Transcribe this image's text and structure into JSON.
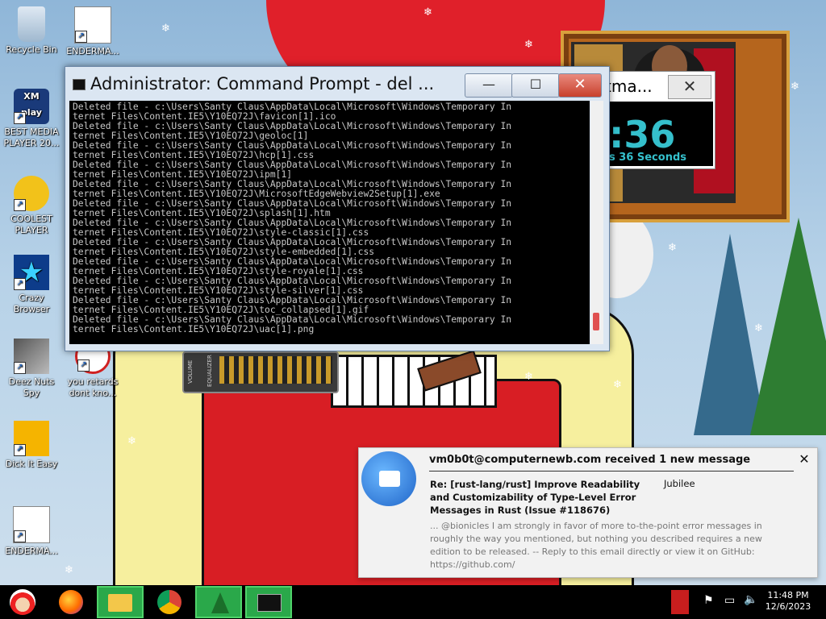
{
  "desktop_icons": [
    {
      "label": "Recycle Bin"
    },
    {
      "label": "ENDERMA..."
    },
    {
      "label": "BEST MEDIA PLAYER 20..."
    },
    {
      "label": "COOLEST PLAYER"
    },
    {
      "label": "Crazy Browser"
    },
    {
      "label": "Deez Nuts Spy"
    },
    {
      "label": "you retards dont kno..."
    },
    {
      "label": "Dick It Easy"
    },
    {
      "label": "ENDERMA..."
    }
  ],
  "xmplay_logo": "XM play",
  "countdown": {
    "title": "tma...",
    "close_glyph": "✕",
    "digits": ":36",
    "subtitle": "s 36 Seconds"
  },
  "cmd_window": {
    "title": "Administrator: Command Prompt - del ...",
    "minimize_glyph": "—",
    "maximize_glyph": "☐",
    "close_glyph": "✕",
    "lines": [
      "Deleted file - c:\\Users\\Santy Claus\\AppData\\Local\\Microsoft\\Windows\\Temporary In",
      "ternet Files\\Content.IE5\\Y10EQ72J\\favicon[1].ico",
      "Deleted file - c:\\Users\\Santy Claus\\AppData\\Local\\Microsoft\\Windows\\Temporary In",
      "ternet Files\\Content.IE5\\Y10EQ72J\\geoloc[1]",
      "Deleted file - c:\\Users\\Santy Claus\\AppData\\Local\\Microsoft\\Windows\\Temporary In",
      "ternet Files\\Content.IE5\\Y10EQ72J\\hcp[1].css",
      "Deleted file - c:\\Users\\Santy Claus\\AppData\\Local\\Microsoft\\Windows\\Temporary In",
      "ternet Files\\Content.IE5\\Y10EQ72J\\ipm[1]",
      "Deleted file - c:\\Users\\Santy Claus\\AppData\\Local\\Microsoft\\Windows\\Temporary In",
      "ternet Files\\Content.IE5\\Y10EQ72J\\MicrosoftEdgeWebview2Setup[1].exe",
      "Deleted file - c:\\Users\\Santy Claus\\AppData\\Local\\Microsoft\\Windows\\Temporary In",
      "ternet Files\\Content.IE5\\Y10EQ72J\\splash[1].htm",
      "Deleted file - c:\\Users\\Santy Claus\\AppData\\Local\\Microsoft\\Windows\\Temporary In",
      "ternet Files\\Content.IE5\\Y10EQ72J\\style-classic[1].css",
      "Deleted file - c:\\Users\\Santy Claus\\AppData\\Local\\Microsoft\\Windows\\Temporary In",
      "ternet Files\\Content.IE5\\Y10EQ72J\\style-embedded[1].css",
      "Deleted file - c:\\Users\\Santy Claus\\AppData\\Local\\Microsoft\\Windows\\Temporary In",
      "ternet Files\\Content.IE5\\Y10EQ72J\\style-royale[1].css",
      "Deleted file - c:\\Users\\Santy Claus\\AppData\\Local\\Microsoft\\Windows\\Temporary In",
      "ternet Files\\Content.IE5\\Y10EQ72J\\style-silver[1].css",
      "Deleted file - c:\\Users\\Santy Claus\\AppData\\Local\\Microsoft\\Windows\\Temporary In",
      "ternet Files\\Content.IE5\\Y10EQ72J\\toc_collapsed[1].gif",
      "Deleted file - c:\\Users\\Santy Claus\\AppData\\Local\\Microsoft\\Windows\\Temporary In",
      "ternet Files\\Content.IE5\\Y10EQ72J\\uac[1].png"
    ]
  },
  "equalizer": {
    "volume_label": "VOLUME",
    "equalizer_label": "EQUALIZER"
  },
  "notification": {
    "header": "vm0b0t@computernewb.com received 1 new message",
    "close_glyph": "✕",
    "subject": "Re: [rust-lang/rust] Improve Readability and Customizability of Type-Level Error Messages in Rust (Issue #118676)",
    "from": "Jubilee",
    "body": "... @bionicles I am strongly in favor of more to-the-point error messages in roughly the way you mentioned, but nothing you described requires a new edition to be released. -- Reply to this email directly or view it on GitHub: https://github.com/"
  },
  "taskbar": {
    "pinned": [
      "start-santa",
      "firefox",
      "file-explorer",
      "chrome",
      "christmas-tree-app",
      "command-prompt"
    ],
    "time": "11:48 PM",
    "date": "12/6/2023"
  },
  "colors": {
    "taskbar_bg": "#000000",
    "active_task": "#2aa84a",
    "countdown_text": "#35c0cc",
    "cmd_text": "#c8c8c8"
  }
}
